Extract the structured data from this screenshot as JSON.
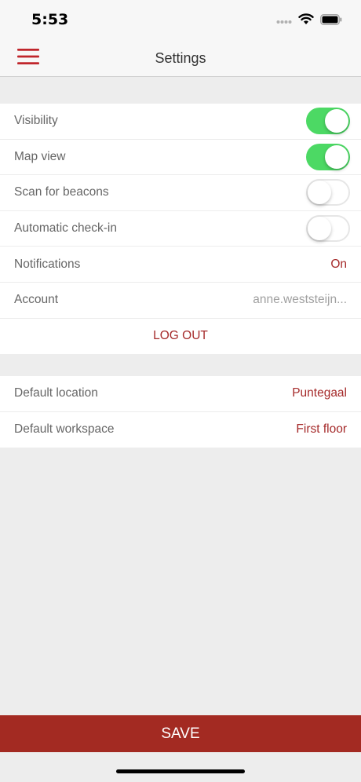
{
  "status_bar": {
    "time": "5:53",
    "icons": [
      "cellular-dots-icon",
      "wifi-icon",
      "battery-icon"
    ]
  },
  "nav": {
    "title": "Settings",
    "menu_icon": "hamburger-menu-icon",
    "accent_color": "#c0262c"
  },
  "settings": {
    "visibility": {
      "label": "Visibility",
      "enabled": true
    },
    "map_view": {
      "label": "Map view",
      "enabled": true
    },
    "scan_beacons": {
      "label": "Scan for beacons",
      "enabled": false
    },
    "auto_checkin": {
      "label": "Automatic check-in",
      "enabled": false
    },
    "notifications": {
      "label": "Notifications",
      "value": "On"
    },
    "account": {
      "label": "Account",
      "value": "anne.weststeijn..."
    },
    "logout_label": "LOG OUT"
  },
  "defaults": {
    "location": {
      "label": "Default location",
      "value": "Puntegaal"
    },
    "workspace": {
      "label": "Default workspace",
      "value": "First floor"
    }
  },
  "save_label": "SAVE",
  "colors": {
    "toggle_on": "#4cd964",
    "accent_red": "#a52a2a",
    "save_bar": "#a32a22"
  }
}
